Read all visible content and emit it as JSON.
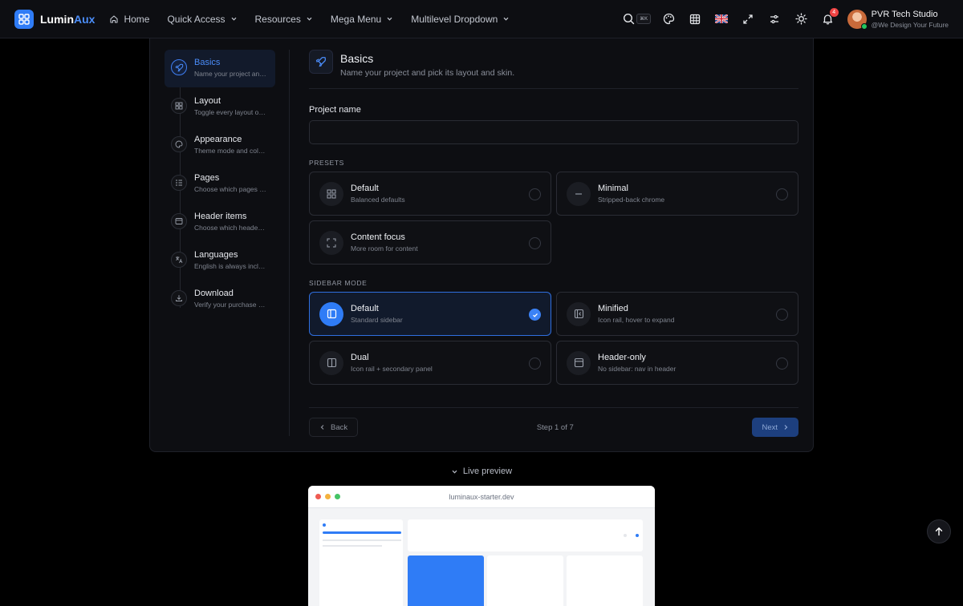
{
  "brand": {
    "name_part1": "Lumin",
    "name_part2": "Aux"
  },
  "nav": {
    "items": [
      {
        "label": "Home",
        "icon": "home-icon"
      },
      {
        "label": "Quick Access",
        "icon": "chevron-down-icon"
      },
      {
        "label": "Resources",
        "icon": "chevron-down-icon"
      },
      {
        "label": "Mega Menu",
        "icon": "chevron-down-icon"
      },
      {
        "label": "Multilevel Dropdown",
        "icon": "chevron-down-icon"
      }
    ],
    "search_shortcut": "⌘K",
    "notification_count": "4"
  },
  "user": {
    "name": "PVR Tech Studio",
    "tagline": "@We Design Your Future"
  },
  "wizard": {
    "steps": [
      {
        "title": "Basics",
        "desc": "Name your project and pick its layout and skin.",
        "icon": "rocket-icon"
      },
      {
        "title": "Layout",
        "desc": "Toggle every layout option.",
        "icon": "grid-icon"
      },
      {
        "title": "Appearance",
        "desc": "Theme mode and colors.",
        "icon": "palette-icon"
      },
      {
        "title": "Pages",
        "desc": "Choose which pages to include.",
        "icon": "list-icon"
      },
      {
        "title": "Header items",
        "desc": "Choose which header items to show.",
        "icon": "window-icon"
      },
      {
        "title": "Languages",
        "desc": "English is always included.",
        "icon": "translate-icon"
      },
      {
        "title": "Download",
        "desc": "Verify your purchase code.",
        "icon": "download-icon"
      }
    ],
    "header": {
      "title": "Basics",
      "subtitle": "Name your project and pick its layout and skin."
    },
    "project_name_label": "Project name",
    "project_name_value": "",
    "presets_label": "PRESETS",
    "presets": [
      {
        "title": "Default",
        "desc": "Balanced defaults",
        "icon": "grid-icon",
        "selected": false
      },
      {
        "title": "Minimal",
        "desc": "Stripped-back chrome",
        "icon": "minus-icon",
        "selected": false
      },
      {
        "title": "Content focus",
        "desc": "More room for content",
        "icon": "expand-icon",
        "selected": false
      }
    ],
    "sidebar_mode_label": "SIDEBAR MODE",
    "sidebar_modes": [
      {
        "title": "Default",
        "desc": "Standard sidebar",
        "icon": "sidebar-icon",
        "selected": true
      },
      {
        "title": "Minified",
        "desc": "Icon rail, hover to expand",
        "icon": "sidebar-collapse-icon",
        "selected": false
      },
      {
        "title": "Dual",
        "desc": "Icon rail + secondary panel",
        "icon": "columns-icon",
        "selected": false
      },
      {
        "title": "Header-only",
        "desc": "No sidebar: nav in header",
        "icon": "window-icon",
        "selected": false
      }
    ],
    "back_label": "Back",
    "step_indicator": "Step 1 of 7",
    "next_label": "Next"
  },
  "preview": {
    "toggle_label": "Live preview",
    "url": "luminaux-starter.dev"
  },
  "colors": {
    "accent": "#2f7cf6",
    "background": "#000000",
    "card": "#0d0e12"
  }
}
